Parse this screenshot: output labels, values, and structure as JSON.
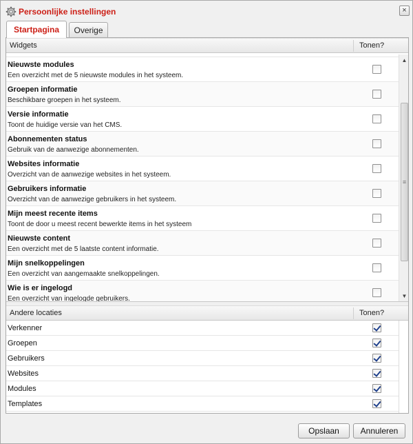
{
  "dialog": {
    "title": "Persoonlijke instellingen",
    "close_label": "×"
  },
  "tabs": [
    {
      "label": "Startpagina",
      "active": true
    },
    {
      "label": "Overige",
      "active": false
    }
  ],
  "widgets": {
    "header_name": "Widgets",
    "header_show": "Tonen?",
    "items": [
      {
        "title": "Nieuwste modules",
        "description": "Een overzicht met de 5 nieuwste modules in het systeem.",
        "checked": false
      },
      {
        "title": "Groepen informatie",
        "description": "Beschikbare groepen in het systeem.",
        "checked": false
      },
      {
        "title": "Versie informatie",
        "description": "Toont de huidige versie van het CMS.",
        "checked": false
      },
      {
        "title": "Abonnementen status",
        "description": "Gebruik van de aanwezige abonnementen.",
        "checked": false
      },
      {
        "title": "Websites informatie",
        "description": "Overzicht van de aanwezige websites in het systeem.",
        "checked": false
      },
      {
        "title": "Gebruikers informatie",
        "description": "Overzicht van de aanwezige gebruikers in het systeem.",
        "checked": false
      },
      {
        "title": "Mijn meest recente items",
        "description": "Toont de door u meest recent bewerkte items in het systeem",
        "checked": false
      },
      {
        "title": "Nieuwste content",
        "description": "Een overzicht met de 5 laatste content informatie.",
        "checked": false
      },
      {
        "title": "Mijn snelkoppelingen",
        "description": "Een overzicht van aangemaakte snelkoppelingen.",
        "checked": false
      },
      {
        "title": "Wie is er ingelogd",
        "description": "Een overzicht van ingelogde gebruikers.",
        "checked": false
      }
    ]
  },
  "locations": {
    "header_name": "Andere locaties",
    "header_show": "Tonen?",
    "items": [
      {
        "label": "Verkenner",
        "checked": true
      },
      {
        "label": "Groepen",
        "checked": true
      },
      {
        "label": "Gebruikers",
        "checked": true
      },
      {
        "label": "Websites",
        "checked": true
      },
      {
        "label": "Modules",
        "checked": true
      },
      {
        "label": "Templates",
        "checked": true
      }
    ]
  },
  "buttons": {
    "save": "Opslaan",
    "cancel": "Annuleren"
  },
  "colors": {
    "title": "#cc1f16",
    "check": "#1e3f8a"
  },
  "icons": {
    "title": "gear-icon",
    "close": "close-icon"
  }
}
